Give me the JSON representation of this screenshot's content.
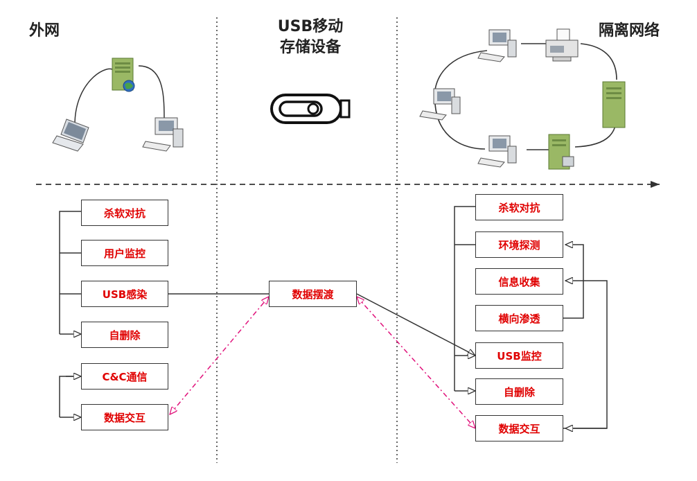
{
  "headers": {
    "external_network": "外网",
    "usb_line1": "USB移动",
    "usb_line2": "存储设备",
    "isolated_network": "隔离网络"
  },
  "left_boxes": [
    "杀软对抗",
    "用户监控",
    "USB感染",
    "自删除",
    "C&C通信",
    "数据交互"
  ],
  "middle_boxes": [
    "数据摆渡"
  ],
  "right_boxes": [
    "杀软对抗",
    "环境探测",
    "信息收集",
    "横向渗透",
    "USB监控",
    "自删除",
    "数据交互"
  ],
  "colors": {
    "box_text": "#e00000",
    "box_border": "#333333",
    "dash_arrow": "#e0107a",
    "server_green": "#8fae5a"
  },
  "icons": [
    "server-icon",
    "laptop-icon",
    "computer-icon",
    "usb-drive-icon",
    "printer-icon"
  ]
}
